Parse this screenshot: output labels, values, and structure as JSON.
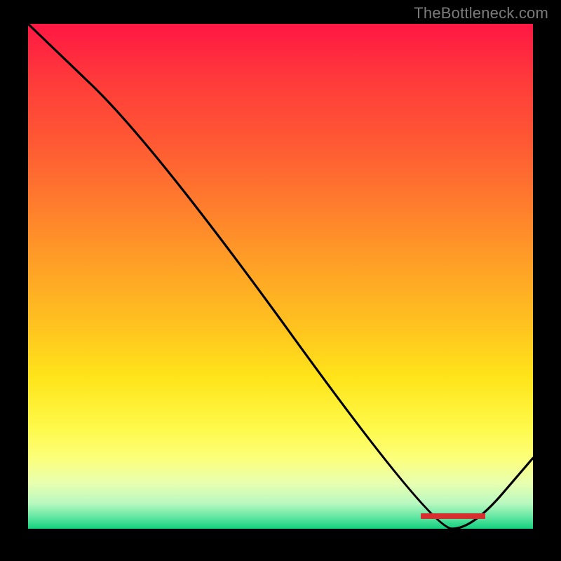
{
  "attribution": "TheBottleneck.com",
  "chart_data": {
    "type": "line",
    "title": "",
    "xlabel": "",
    "ylabel": "",
    "xlim": [
      0,
      100
    ],
    "ylim": [
      0,
      100
    ],
    "series": [
      {
        "name": "curve",
        "x": [
          0,
          25,
          80,
          88,
          100
        ],
        "y": [
          100,
          76,
          0,
          0,
          14
        ]
      }
    ],
    "annotations": [
      {
        "name": "redacted-label",
        "x": 84,
        "y": 2
      }
    ]
  },
  "colors": {
    "background": "#000000",
    "line": "#000000",
    "gradient_top": "#ff1744",
    "gradient_bottom": "#12d07e",
    "attribution": "#7b7b7b",
    "redacted": "#d62f2f"
  }
}
